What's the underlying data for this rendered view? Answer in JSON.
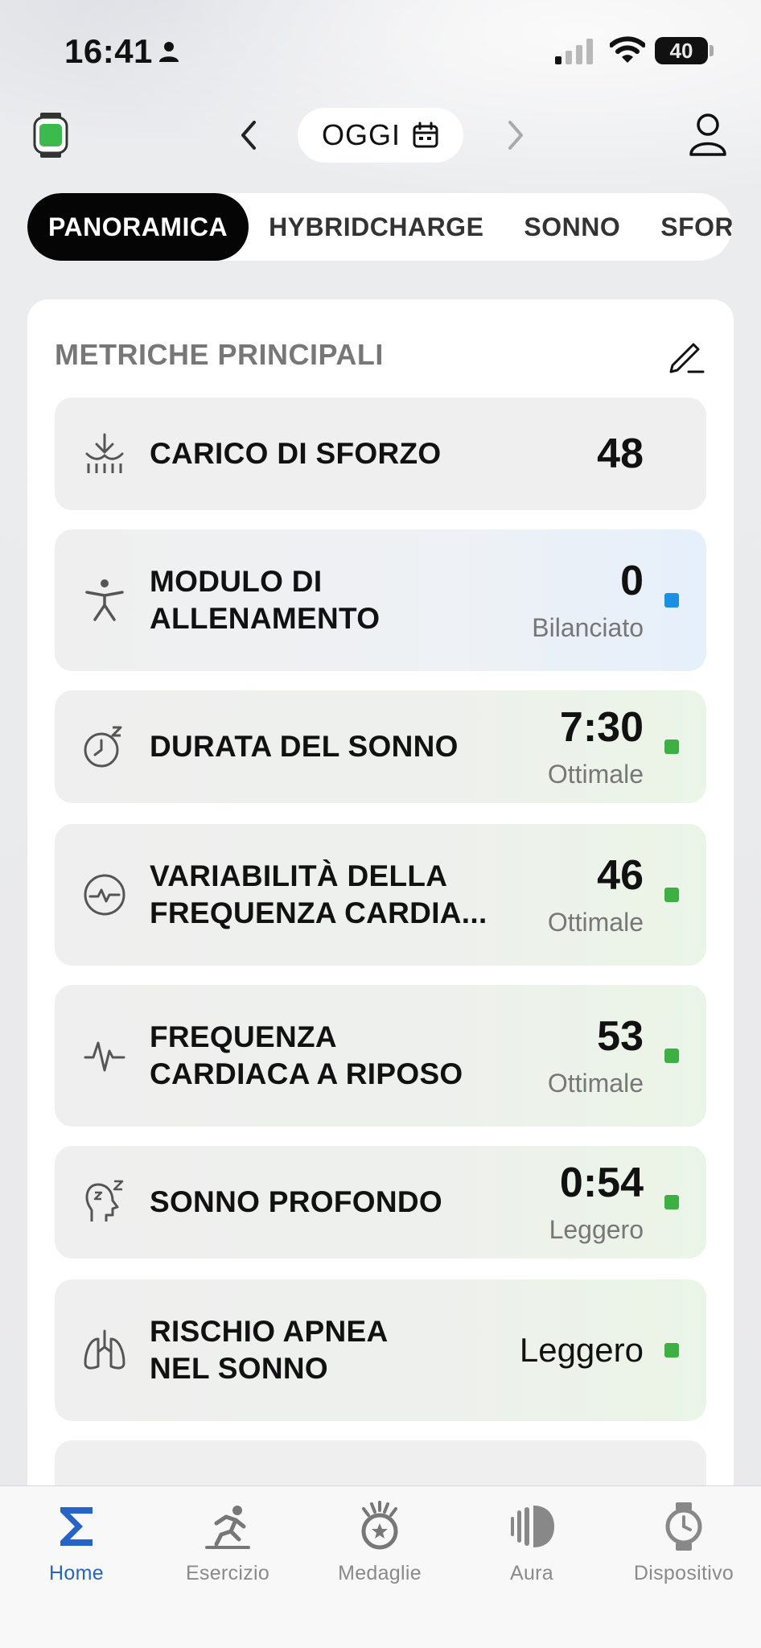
{
  "status_bar": {
    "time": "16:41",
    "battery": "40"
  },
  "header": {
    "date_label": "OGGI"
  },
  "tabs": [
    {
      "label": "PANORAMICA",
      "active": true
    },
    {
      "label": "HYBRIDCHARGE",
      "active": false
    },
    {
      "label": "SONNO",
      "active": false
    },
    {
      "label": "SFOR",
      "active": false
    }
  ],
  "section": {
    "title": "METRICHE PRINCIPALI"
  },
  "metrics": [
    {
      "label": "CARICO DI SFORZO",
      "value": "48",
      "status": "",
      "dot_color": ""
    },
    {
      "label_line1": "MODULO DI",
      "label_line2": "ALLENAMENTO",
      "value": "0",
      "status": "Bilanciato",
      "dot_color": "#1a8fe3"
    },
    {
      "label": "DURATA DEL SONNO",
      "value": "7:30",
      "status": "Ottimale",
      "dot_color": "#3cb043"
    },
    {
      "label_line1": "VARIABILITÀ DELLA",
      "label_line2": "FREQUENZA CARDIA...",
      "value": "46",
      "status": "Ottimale",
      "dot_color": "#3cb043"
    },
    {
      "label_line1": "FREQUENZA",
      "label_line2": "CARDIACA A RIPOSO",
      "value": "53",
      "status": "Ottimale",
      "dot_color": "#3cb043"
    },
    {
      "label": "SONNO PROFONDO",
      "value": "0:54",
      "status": "Leggero",
      "dot_color": "#3cb043"
    },
    {
      "label_line1": "RISCHIO APNEA",
      "label_line2": "NEL SONNO",
      "value": "Leggero",
      "status": "",
      "dot_color": "#3cb043"
    }
  ],
  "nav": [
    {
      "label": "Home",
      "icon": "sigma-icon",
      "active": true
    },
    {
      "label": "Esercizio",
      "icon": "running-icon",
      "active": false
    },
    {
      "label": "Medaglie",
      "icon": "medal-icon",
      "active": false
    },
    {
      "label": "Aura",
      "icon": "aura-icon",
      "active": false
    },
    {
      "label": "Dispositivo",
      "icon": "watch-icon",
      "active": false
    }
  ],
  "colors": {
    "accent": "#2563c9",
    "tab_active_bg": "#050505",
    "status_green": "#3cb043",
    "status_blue": "#1a8fe3"
  }
}
